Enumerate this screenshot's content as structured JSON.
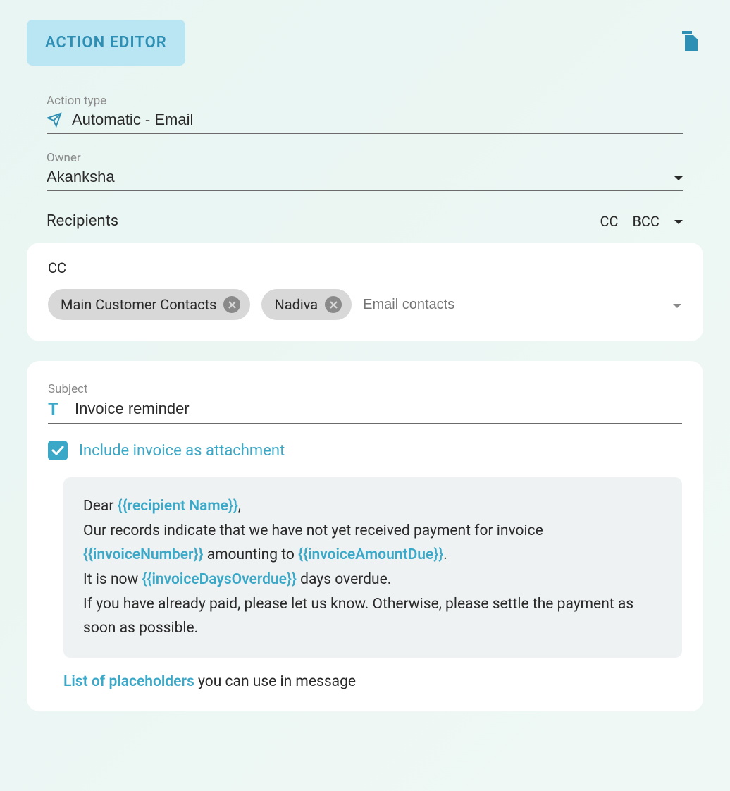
{
  "header": {
    "title": "ACTION EDITOR"
  },
  "fields": {
    "action_type": {
      "label": "Action type",
      "value": "Automatic - Email"
    },
    "owner": {
      "label": "Owner",
      "value": "Akanksha"
    }
  },
  "recipients": {
    "label": "Recipients",
    "cc_btn": "CC",
    "bcc_btn": "BCC"
  },
  "cc_section": {
    "label": "CC",
    "chips": [
      "Main Customer Contacts",
      "Nadiva"
    ],
    "placeholder": "Email contacts"
  },
  "subject": {
    "label": "Subject",
    "value": "Invoice reminder"
  },
  "attachment": {
    "checked": true,
    "label": "Include invoice as attachment"
  },
  "message": {
    "parts": [
      {
        "text": "Dear "
      },
      {
        "placeholder": "{{recipient Name}}"
      },
      {
        "text": ","
      },
      {
        "br": true
      },
      {
        "text": "Our records indicate that we have not yet received payment for invoice "
      },
      {
        "placeholder": "{{invoiceNumber}}"
      },
      {
        "text": " amounting to "
      },
      {
        "placeholder": "{{invoiceAmountDue}}"
      },
      {
        "text": "."
      },
      {
        "br": true
      },
      {
        "text": "It is now "
      },
      {
        "placeholder": "{{invoiceDaysOverdue}}"
      },
      {
        "text": " days overdue."
      },
      {
        "br": true
      },
      {
        "text": "If you have already paid, please let us know. Otherwise, please settle the payment as soon as possible."
      }
    ]
  },
  "footer": {
    "link_text": "List of placeholders",
    "rest_text": " you can use in message"
  },
  "colors": {
    "accent": "#3ba8c7",
    "badge_bg": "#bae5f3",
    "badge_text": "#2d8fb3"
  }
}
